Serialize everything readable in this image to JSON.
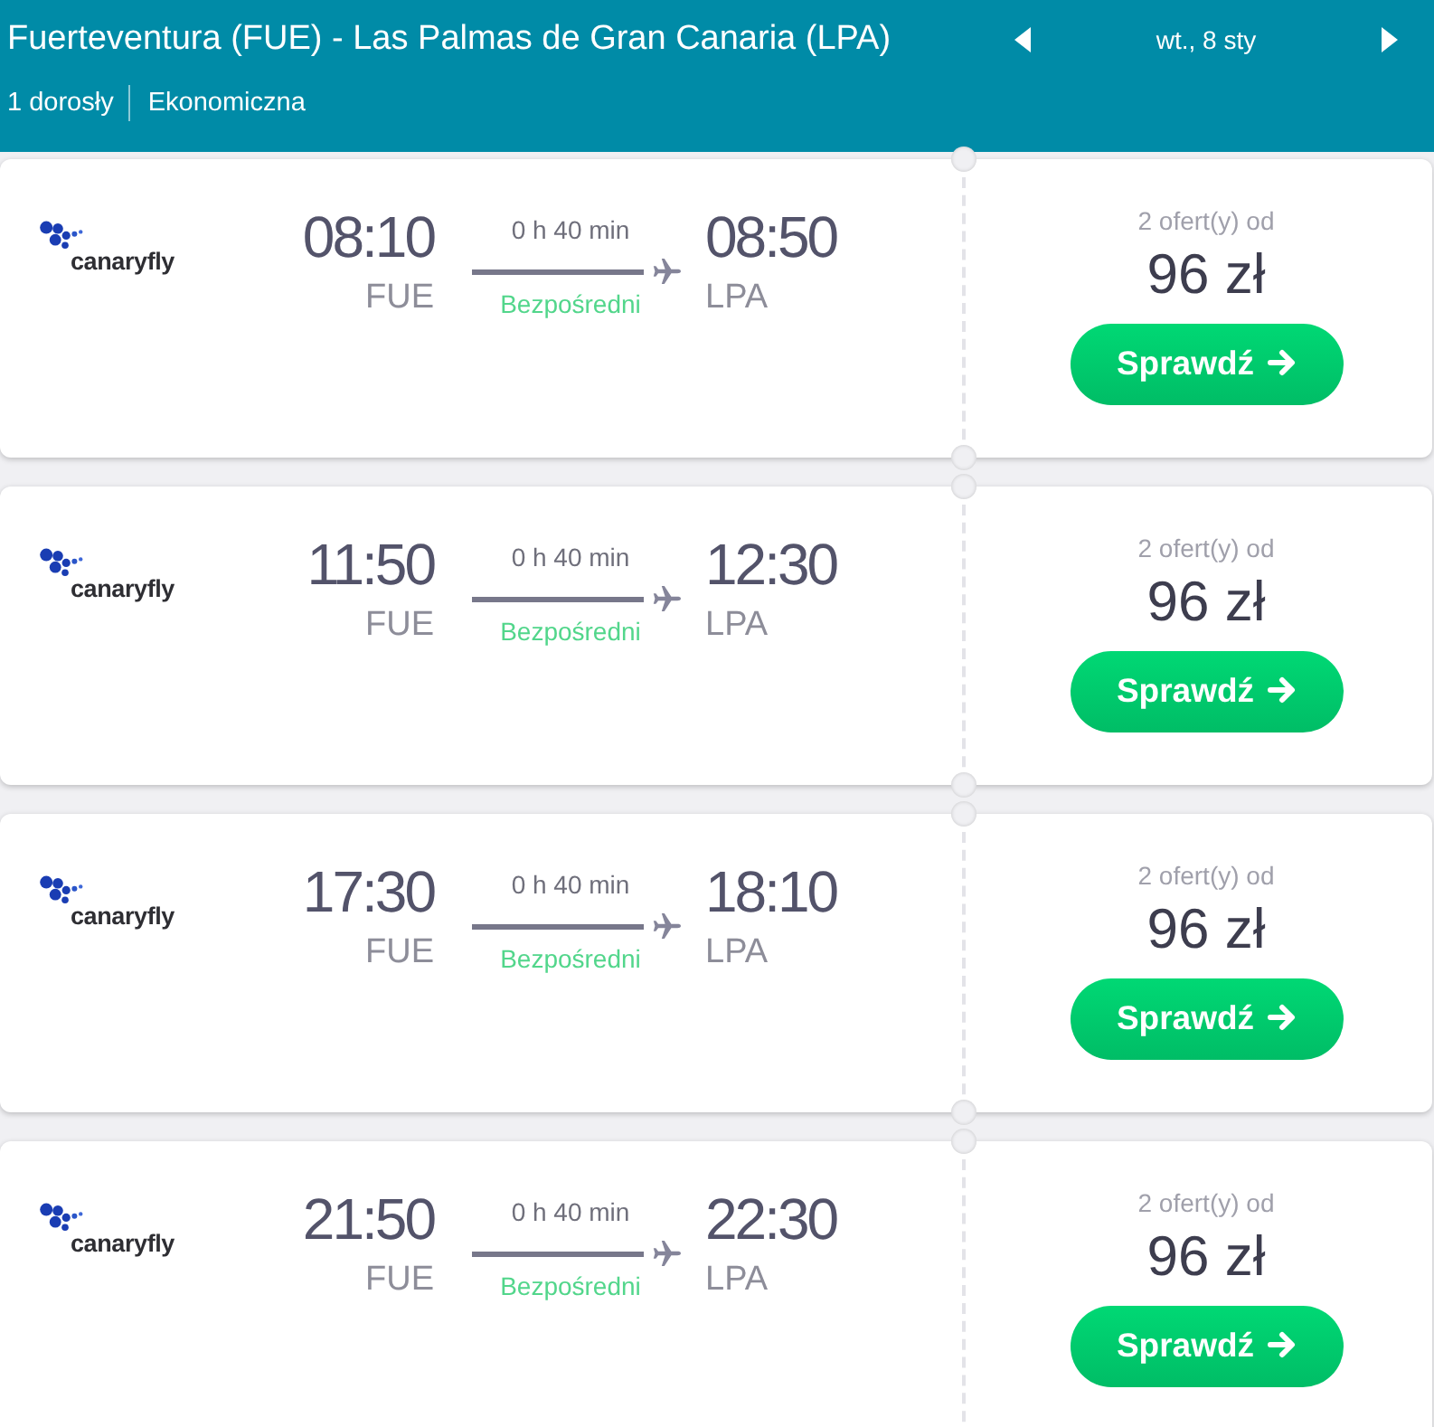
{
  "header": {
    "route": "Fuerteventura (FUE) - Las Palmas de Gran Canaria (LPA)",
    "date": "wt., 8 sty",
    "passengers": "1 dorosły",
    "cabin_class": "Ekonomiczna"
  },
  "flights": [
    {
      "airline": "canaryfly",
      "departure_time": "08:10",
      "departure_airport": "FUE",
      "duration": "0 h 40 min",
      "stops": "Bezpośredni",
      "arrival_time": "08:50",
      "arrival_airport": "LPA",
      "offers": "2 ofert(y) od",
      "price": "96 zł",
      "button": "Sprawdź"
    },
    {
      "airline": "canaryfly",
      "departure_time": "11:50",
      "departure_airport": "FUE",
      "duration": "0 h 40 min",
      "stops": "Bezpośredni",
      "arrival_time": "12:30",
      "arrival_airport": "LPA",
      "offers": "2 ofert(y) od",
      "price": "96 zł",
      "button": "Sprawdź"
    },
    {
      "airline": "canaryfly",
      "departure_time": "17:30",
      "departure_airport": "FUE",
      "duration": "0 h 40 min",
      "stops": "Bezpośredni",
      "arrival_time": "18:10",
      "arrival_airport": "LPA",
      "offers": "2 ofert(y) od",
      "price": "96 zł",
      "button": "Sprawdź"
    },
    {
      "airline": "canaryfly",
      "departure_time": "21:50",
      "departure_airport": "FUE",
      "duration": "0 h 40 min",
      "stops": "Bezpośredni",
      "arrival_time": "22:30",
      "arrival_airport": "LPA",
      "offers": "2 ofert(y) od",
      "price": "96 zł",
      "button": "Sprawdź"
    }
  ]
}
